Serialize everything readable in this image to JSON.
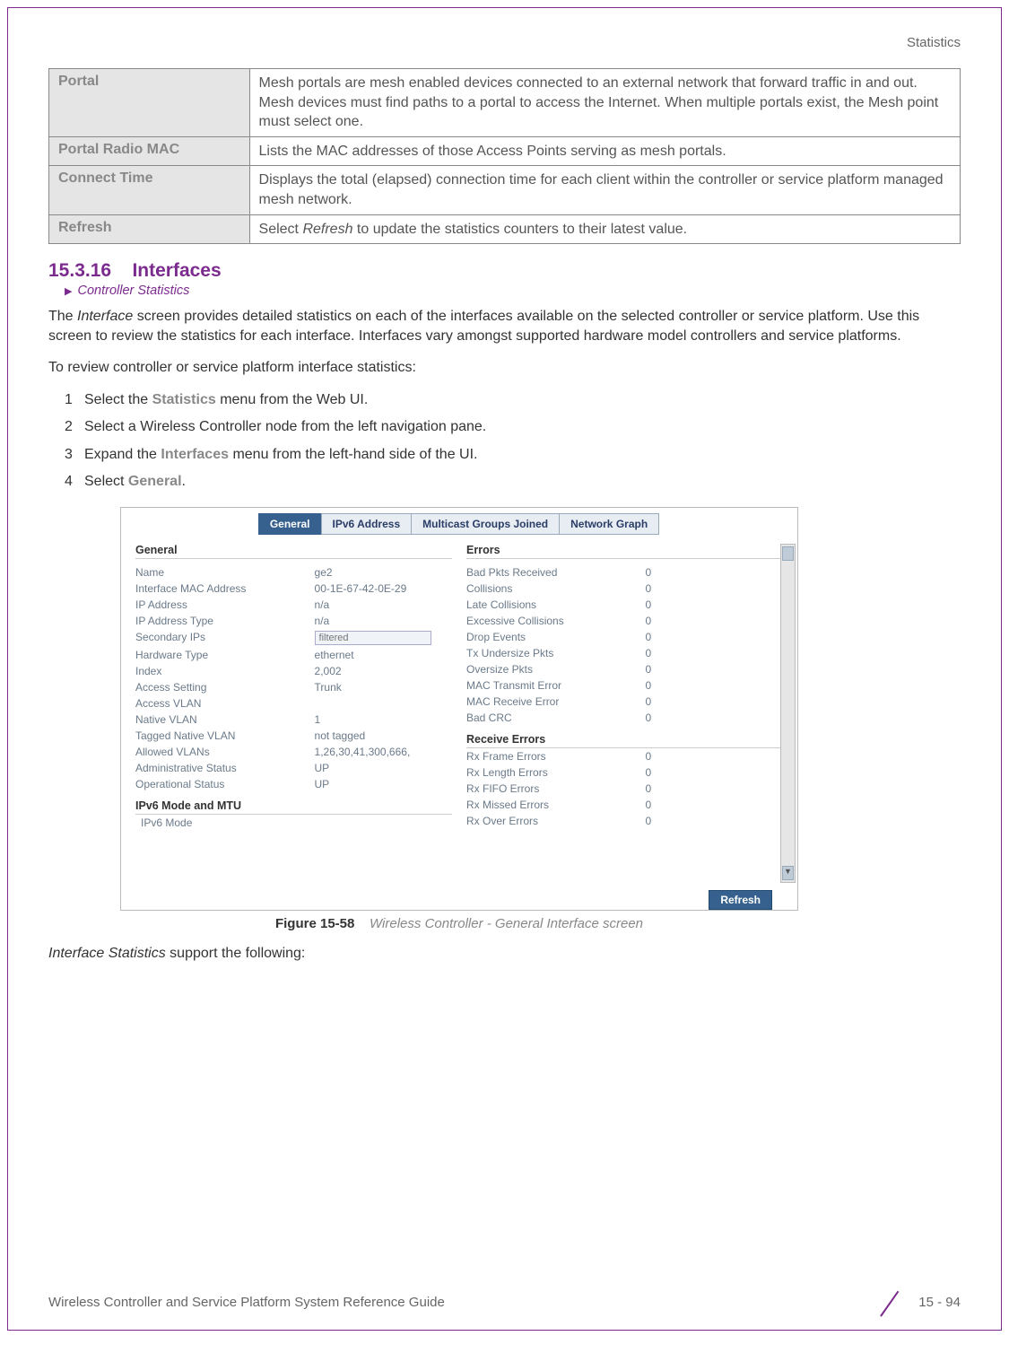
{
  "header": {
    "section": "Statistics"
  },
  "defTable": [
    {
      "term": "Portal",
      "desc": "Mesh portals are mesh enabled devices connected to an external network that forward traffic in and out. Mesh devices must find paths to a portal to access the Internet. When multiple portals exist, the Mesh point must select one."
    },
    {
      "term": "Portal Radio MAC",
      "desc": "Lists the MAC addresses of those Access Points serving as mesh portals."
    },
    {
      "term": "Connect Time",
      "desc": "Displays the total (elapsed) connection time for each client within the controller or service platform managed mesh network."
    },
    {
      "term": "Refresh",
      "desc_pre": "Select ",
      "desc_em": "Refresh",
      "desc_post": " to update the statistics counters to their latest value."
    }
  ],
  "section": {
    "number": "15.3.16",
    "title": "Interfaces",
    "breadcrumb": "Controller Statistics"
  },
  "para1_pre": "The ",
  "para1_em": "Interface",
  "para1_post": " screen provides detailed statistics on each of the interfaces available on the selected controller or service platform. Use this screen to review the statistics for each interface. Interfaces vary amongst supported hardware model controllers and service platforms.",
  "para2": "To review controller or service platform interface statistics:",
  "steps": [
    {
      "n": "1",
      "pre": "Select the ",
      "b": "Statistics",
      "post": " menu from the Web UI."
    },
    {
      "n": "2",
      "pre": "Select a Wireless Controller node from the left navigation pane.",
      "b": "",
      "post": ""
    },
    {
      "n": "3",
      "pre": "Expand the ",
      "b": "Interfaces",
      "post": " menu from the left-hand side of the UI."
    },
    {
      "n": "4",
      "pre": "Select ",
      "b": "General",
      "post": "."
    }
  ],
  "figure": {
    "tabs": [
      "General",
      "IPv6 Address",
      "Multicast Groups Joined",
      "Network Graph"
    ],
    "activeTab": "General",
    "left": {
      "title": "General",
      "rows": [
        {
          "k": "Name",
          "v": "ge2"
        },
        {
          "k": "Interface MAC Address",
          "v": "00-1E-67-42-0E-29"
        },
        {
          "k": "IP Address",
          "v": "n/a"
        },
        {
          "k": "IP Address Type",
          "v": "n/a"
        },
        {
          "k": "Secondary IPs",
          "v": "",
          "input": true,
          "placeholder": "filtered"
        },
        {
          "k": "Hardware Type",
          "v": "ethernet"
        },
        {
          "k": "Index",
          "v": "2,002"
        },
        {
          "k": "Access Setting",
          "v": "Trunk"
        },
        {
          "k": "Access VLAN",
          "v": ""
        },
        {
          "k": "Native VLAN",
          "v": "1"
        },
        {
          "k": "Tagged Native VLAN",
          "v": "not tagged"
        },
        {
          "k": "Allowed VLANs",
          "v": "1,26,30,41,300,666,"
        },
        {
          "k": "Administrative Status",
          "v": "UP"
        },
        {
          "k": "Operational Status",
          "v": "UP"
        }
      ],
      "ipv6Title": "IPv6 Mode and MTU",
      "ipv6Row": {
        "k": "IPv6 Mode",
        "v": ""
      }
    },
    "right": {
      "errTitle": "Errors",
      "errRows": [
        {
          "k": "Bad Pkts Received",
          "v": "0"
        },
        {
          "k": "Collisions",
          "v": "0"
        },
        {
          "k": "Late Collisions",
          "v": "0"
        },
        {
          "k": "Excessive Collisions",
          "v": "0"
        },
        {
          "k": "Drop Events",
          "v": "0"
        },
        {
          "k": "Tx Undersize Pkts",
          "v": "0"
        },
        {
          "k": "Oversize Pkts",
          "v": "0"
        },
        {
          "k": "MAC Transmit Error",
          "v": "0"
        },
        {
          "k": "MAC Receive Error",
          "v": "0"
        },
        {
          "k": "Bad CRC",
          "v": "0"
        }
      ],
      "rxTitle": "Receive Errors",
      "rxRows": [
        {
          "k": "Rx Frame Errors",
          "v": "0"
        },
        {
          "k": "Rx Length Errors",
          "v": "0"
        },
        {
          "k": "Rx FIFO Errors",
          "v": "0"
        },
        {
          "k": "Rx Missed Errors",
          "v": "0"
        },
        {
          "k": "Rx Over Errors",
          "v": "0"
        }
      ]
    },
    "refresh": "Refresh"
  },
  "figCaption": {
    "label": "Figure 15-58",
    "text": "Wireless Controller - General Interface screen"
  },
  "closingLine_em": "Interface Statistics",
  "closingLine_post": " support the following:",
  "footer": {
    "left": "Wireless Controller and Service Platform System Reference Guide",
    "right": "15 - 94"
  }
}
